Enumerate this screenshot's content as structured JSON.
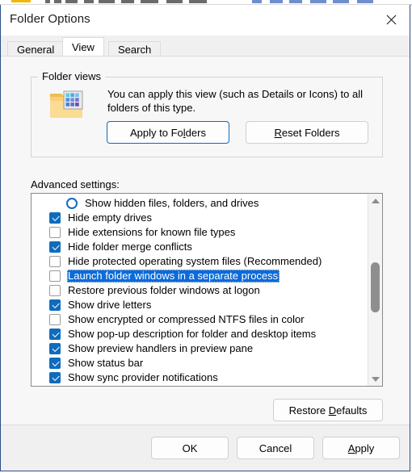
{
  "background_window": {
    "visible": true
  },
  "window": {
    "title": "Folder Options",
    "close_icon": "close-icon"
  },
  "tabs": [
    {
      "id": "general",
      "label": "General",
      "active": false
    },
    {
      "id": "view",
      "label": "View",
      "active": true
    },
    {
      "id": "search",
      "label": "Search",
      "active": false
    }
  ],
  "folder_views": {
    "legend": "Folder views",
    "icon": "folder-view-icon",
    "description": "You can apply this view (such as Details or Icons) to all folders of this type.",
    "apply_to_folders": {
      "label": "Apply to Folders",
      "accel": "l",
      "focused": true
    },
    "reset_folders": {
      "label": "Reset Folders",
      "accel": "R"
    }
  },
  "advanced": {
    "label": "Advanced settings:",
    "items": [
      {
        "type": "radio",
        "label": "Show hidden files, folders, and drives",
        "checked": false,
        "indent": true,
        "selected": false
      },
      {
        "type": "checkbox",
        "label": "Hide empty drives",
        "checked": true,
        "indent": false,
        "selected": false
      },
      {
        "type": "checkbox",
        "label": "Hide extensions for known file types",
        "checked": false,
        "indent": false,
        "selected": false
      },
      {
        "type": "checkbox",
        "label": "Hide folder merge conflicts",
        "checked": true,
        "indent": false,
        "selected": false
      },
      {
        "type": "checkbox",
        "label": "Hide protected operating system files (Recommended)",
        "checked": false,
        "indent": false,
        "selected": false
      },
      {
        "type": "checkbox",
        "label": "Launch folder windows in a separate process",
        "checked": false,
        "indent": false,
        "selected": true
      },
      {
        "type": "checkbox",
        "label": "Restore previous folder windows at logon",
        "checked": false,
        "indent": false,
        "selected": false
      },
      {
        "type": "checkbox",
        "label": "Show drive letters",
        "checked": true,
        "indent": false,
        "selected": false
      },
      {
        "type": "checkbox",
        "label": "Show encrypted or compressed NTFS files in color",
        "checked": false,
        "indent": false,
        "selected": false
      },
      {
        "type": "checkbox",
        "label": "Show pop-up description for folder and desktop items",
        "checked": true,
        "indent": false,
        "selected": false
      },
      {
        "type": "checkbox",
        "label": "Show preview handlers in preview pane",
        "checked": true,
        "indent": false,
        "selected": false
      },
      {
        "type": "checkbox",
        "label": "Show status bar",
        "checked": true,
        "indent": false,
        "selected": false
      },
      {
        "type": "checkbox",
        "label": "Show sync provider notifications",
        "checked": true,
        "indent": false,
        "selected": false
      }
    ],
    "scrollbar": {
      "up_icon": "scroll-up-arrow-icon",
      "down_icon": "scroll-down-arrow-icon"
    }
  },
  "restore_defaults": {
    "label": "Restore Defaults",
    "accel": "D"
  },
  "footer": {
    "ok": {
      "label": "OK"
    },
    "cancel": {
      "label": "Cancel"
    },
    "apply": {
      "label": "Apply",
      "accel": "A"
    }
  },
  "colors": {
    "accent_blue": "#0f6cbd",
    "selection_blue": "#0a6bdb",
    "focus_border": "#0d6bbd",
    "dialog_bg": "#f7f7f7",
    "list_bg": "#ffffff"
  }
}
